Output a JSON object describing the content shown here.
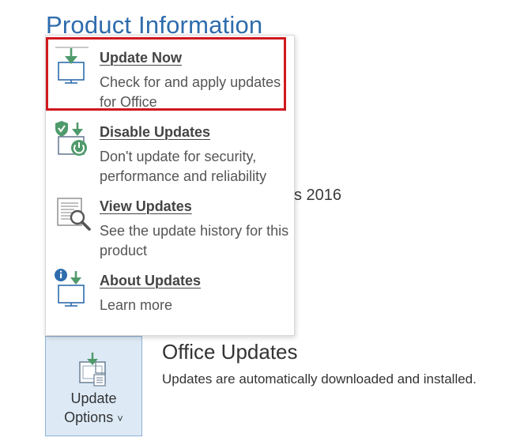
{
  "page": {
    "title": "Product Information",
    "background_fragment": "s 2016"
  },
  "menu": {
    "items": [
      {
        "title": "Update Now",
        "description": "Check for and apply updates for Office",
        "icon": "update-now-icon",
        "highlighted": true
      },
      {
        "title": "Disable Updates",
        "description": "Don't update for security, performance and reliability",
        "icon": "disable-updates-icon"
      },
      {
        "title": "View Updates",
        "description": "See the update history for this product",
        "icon": "view-updates-icon"
      },
      {
        "title": "About Updates",
        "description": "Learn more",
        "icon": "about-updates-icon"
      }
    ]
  },
  "update_options_button": {
    "label_line1": "Update",
    "label_line2": "Options",
    "chevron": "˅",
    "icon": "update-options-icon"
  },
  "office_updates": {
    "heading": "Office Updates",
    "description": "Updates are automatically downloaded and installed."
  },
  "colors": {
    "title_blue": "#2e6cad",
    "icon_green": "#4f9a6b",
    "icon_blue": "#2e6cad",
    "highlight_red": "#d0181e",
    "button_bg": "#ddeaf6"
  }
}
